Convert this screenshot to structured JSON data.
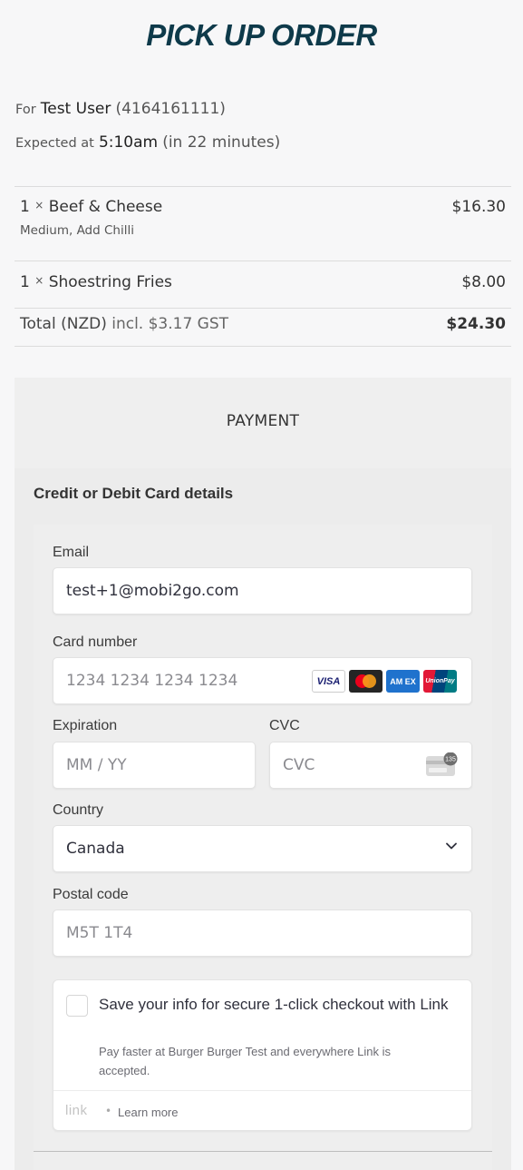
{
  "title": "PICK UP ORDER",
  "order_info": {
    "for_prefix": "For",
    "customer": "Test User",
    "phone": "(4164161111)",
    "expected_prefix": "Expected at",
    "time": "5:10am",
    "eta": "(in 22 minutes)"
  },
  "items": [
    {
      "qty": "1",
      "times": "×",
      "name": "Beef & Cheese",
      "price": "$16.30",
      "modifiers": "Medium, Add Chilli"
    },
    {
      "qty": "1",
      "times": "×",
      "name": "Shoestring Fries",
      "price": "$8.00",
      "modifiers": ""
    }
  ],
  "total": {
    "label": "Total (NZD)",
    "gst": "incl. $3.17 GST",
    "amount": "$24.30"
  },
  "payment": {
    "header": "PAYMENT",
    "card_title": "Credit or Debit Card details",
    "email_label": "Email",
    "email_value": "test+1@mobi2go.com",
    "card_label": "Card number",
    "card_placeholder": "1234 1234 1234 1234",
    "brands": {
      "visa": "VISA",
      "amex": "AM EX",
      "unionpay": "UnionPay"
    },
    "expiration_label": "Expiration",
    "expiration_placeholder": "MM / YY",
    "cvc_label": "CVC",
    "cvc_placeholder": "CVC",
    "cvc_badge": "135",
    "country_label": "Country",
    "country_value": "Canada",
    "postal_label": "Postal code",
    "postal_placeholder": "M5T 1T4",
    "link": {
      "title": "Save your info for secure 1-click checkout with Link",
      "description": "Pay faster at Burger Burger Test and everywhere Link is accepted.",
      "logo": "link",
      "separator": "•",
      "learn_more": "Learn more"
    }
  }
}
